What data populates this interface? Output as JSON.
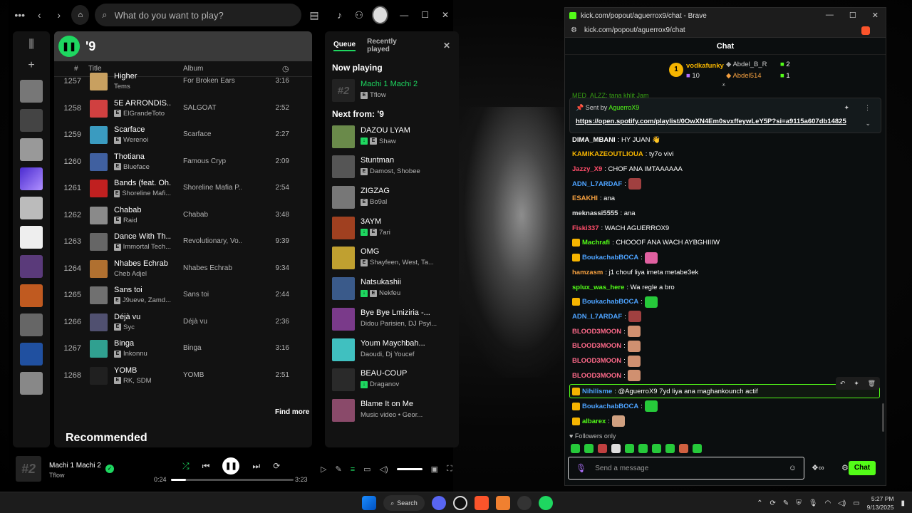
{
  "spotify": {
    "search_placeholder": "What do you want to play?",
    "playlist_title": "'9",
    "columns": {
      "num": "#",
      "title": "Title",
      "album": "Album"
    },
    "tracks": [
      {
        "num": "1257",
        "title": "Higher",
        "artist": "Tems",
        "explicit": false,
        "album": "For Broken Ears",
        "duration": "3:16",
        "color": "#c8a060"
      },
      {
        "num": "1258",
        "title": "5E ARRONDIS...",
        "artist": "ElGrandeToto",
        "explicit": true,
        "album": "SALGOAT",
        "duration": "2:52",
        "color": "#d04040"
      },
      {
        "num": "1259",
        "title": "Scarface",
        "artist": "Werenoi",
        "explicit": true,
        "album": "Scarface",
        "duration": "2:27",
        "color": "#3a9bc0"
      },
      {
        "num": "1260",
        "title": "Thotiana",
        "artist": "Blueface",
        "explicit": true,
        "album": "Famous Cryp",
        "duration": "2:09",
        "color": "#4060a0"
      },
      {
        "num": "1261",
        "title": "Bands (feat. Oh...",
        "artist": "Shoreline Mafi...",
        "explicit": true,
        "album": "Shoreline Mafia P...",
        "duration": "2:54",
        "color": "#c02020"
      },
      {
        "num": "1262",
        "title": "Chabab",
        "artist": "Raid",
        "explicit": true,
        "album": "Chabab",
        "duration": "3:48",
        "color": "#8a8a8a"
      },
      {
        "num": "1263",
        "title": "Dance With Th...",
        "artist": "Immortal Tech...",
        "explicit": true,
        "album": "Revolutionary, Vo...",
        "duration": "9:39",
        "color": "#666"
      },
      {
        "num": "1264",
        "title": "Nhabes Echrab",
        "artist": "Cheb Adjel",
        "explicit": false,
        "album": "Nhabes Echrab",
        "duration": "9:34",
        "color": "#b07030"
      },
      {
        "num": "1265",
        "title": "Sans toi",
        "artist": "J9ueve, Zamd...",
        "explicit": true,
        "album": "Sans toi",
        "duration": "2:44",
        "color": "#707070"
      },
      {
        "num": "1266",
        "title": "Déjà vu",
        "artist": "Syc",
        "explicit": true,
        "album": "Déjà vu",
        "duration": "2:36",
        "color": "#505070"
      },
      {
        "num": "1267",
        "title": "Binga",
        "artist": "Inkonnu",
        "explicit": true,
        "album": "Binga",
        "duration": "3:16",
        "color": "#30a090"
      },
      {
        "num": "1268",
        "title": "YOMB",
        "artist": "RK, SDM",
        "explicit": true,
        "album": "YOMB",
        "duration": "2:51",
        "color": "#202020"
      }
    ],
    "find_more": "Find more",
    "recommended": "Recommended",
    "queue": {
      "tab_queue": "Queue",
      "tab_recent": "Recently played",
      "now_playing_label": "Now playing",
      "now_playing": {
        "title": "Machi 1 Machi 2",
        "artist": "Tflow"
      },
      "next_label": "Next from: '9",
      "items": [
        {
          "title": "DAZOU LYAM",
          "artist": "Shaw",
          "dl": true,
          "explicit": true,
          "color": "#6a8a4a"
        },
        {
          "title": "Stuntman",
          "artist": "Damost, Shobee",
          "dl": false,
          "explicit": true,
          "color": "#555"
        },
        {
          "title": "ZIGZAG",
          "artist": "Bo9al",
          "dl": false,
          "explicit": true,
          "color": "#777"
        },
        {
          "title": "3AYM",
          "artist": "7ari",
          "dl": true,
          "explicit": true,
          "color": "#a04020"
        },
        {
          "title": "OMG",
          "artist": "Shayfeen, West, Ta...",
          "dl": false,
          "explicit": true,
          "color": "#c0a030"
        },
        {
          "title": "Natsukashii",
          "artist": "Nekfeu",
          "dl": true,
          "explicit": true,
          "color": "#3a5a8a"
        },
        {
          "title": "Bye Bye Lmiziria -...",
          "artist": "Didou Parisien, DJ Psyi...",
          "dl": false,
          "explicit": false,
          "color": "#7a3a8a"
        },
        {
          "title": "Youm Maychbah...",
          "artist": "Daoudi, Dj Youcef",
          "dl": false,
          "explicit": false,
          "color": "#40c0c0"
        },
        {
          "title": "BEAU-COUP",
          "artist": "Draganov",
          "dl": true,
          "explicit": false,
          "color": "#2a2a2a"
        },
        {
          "title": "Blame It on Me",
          "artist": "Music video • Geor...",
          "dl": false,
          "explicit": false,
          "color": "#8a4a6a"
        }
      ]
    },
    "player": {
      "art_text": "#2",
      "title": "Machi 1 Machi 2",
      "artist": "Tflow",
      "current": "0:24",
      "total": "3:23",
      "progress": 0.12
    }
  },
  "browser": {
    "title": "kick.com/popout/aguerrox9/chat - Brave",
    "url": "kick.com/popout/aguerrox9/chat",
    "chat_header": "Chat",
    "leaders": {
      "first": {
        "rank": "1",
        "name": "vodkafunky",
        "count": "10"
      },
      "second": {
        "name": "Abdel_B_R",
        "count": "2"
      },
      "third": {
        "name": "Abdel514",
        "count": "1"
      }
    },
    "pinned": {
      "sent_by": "Sent by",
      "user": "AguerroX9",
      "link": "https://open.spotify.com/playlist/0OwXN4Em0svxffeywLeY5P?si=a9115a607db14825"
    },
    "partial_top": "MED_ALZZ: tana khlit Jam",
    "messages": [
      {
        "user": "DIMA_MBANI",
        "color": "#ffffff",
        "text": ": HY JUAN 👋"
      },
      {
        "user": "KAMIKAZEOUTLIOUA",
        "color": "#f5b400",
        "text": ": ty7o vivi"
      },
      {
        "user": "Jazzy_X9",
        "color": "#ff4d6a",
        "text": ": CHOF ANA IMTAAAAAA"
      },
      {
        "user": "ADN_L7ARDAF",
        "color": "#4da3ff",
        "text": ":",
        "emote": "#a04040"
      },
      {
        "user": "ESAKHI",
        "color": "#f5a040",
        "text": ": ana"
      },
      {
        "user": "meknassi5555",
        "color": "#e0e0e0",
        "text": ": ana"
      },
      {
        "user": "Fiski337",
        "color": "#ff4d6a",
        "text": ": WACH AGUERROX9"
      },
      {
        "user": "Machrafi",
        "color": "#53fc18",
        "text": ": CHOOOF ANA WACH AYBGHIIIW",
        "badge": true
      },
      {
        "user": "BoukachabBOCA",
        "color": "#4da3ff",
        "text": ":",
        "emote": "#e060a0",
        "badge": true
      },
      {
        "user": "hamzasm",
        "color": "#f5a040",
        "text": ": j1 chouf liya imeta metabe3ek"
      },
      {
        "user": "splux_was_here",
        "color": "#53fc18",
        "text": ": Wa regle a bro"
      },
      {
        "user": "BoukachabBOCA",
        "color": "#4da3ff",
        "text": ":",
        "emote": "#26c93a",
        "badge": true
      },
      {
        "user": "ADN_L7ARDAF",
        "color": "#4da3ff",
        "text": ":",
        "emote": "#a04040"
      },
      {
        "user": "BLOOD3MOON",
        "color": "#ff6a8a",
        "text": ":",
        "emote": "#d09070"
      },
      {
        "user": "BLOOD3MOON",
        "color": "#ff6a8a",
        "text": ":",
        "emote": "#d09070"
      },
      {
        "user": "BLOOD3MOON",
        "color": "#ff6a8a",
        "text": ":",
        "emote": "#d09070"
      },
      {
        "user": "BLOOD3MOON",
        "color": "#ff6a8a",
        "text": ":",
        "emote": "#d09070"
      }
    ],
    "highlighted": {
      "user": "Nihilisme",
      "color": "#4da3ff",
      "text": ": @AguerroX9 7yd liya ana maghankounch actif"
    },
    "after": [
      {
        "user": "BoukachabBOCA",
        "color": "#4da3ff",
        "text": ":",
        "emote": "#26c93a",
        "badge": true
      },
      {
        "user": "albarex",
        "color": "#53fc18",
        "text": ":",
        "emote": "#d0a080",
        "badge": true
      }
    ],
    "followers_only": "Followers only",
    "input_placeholder": "Send a message",
    "chat_button": "Chat"
  },
  "taskbar": {
    "search": "Search",
    "time": "5:27 PM",
    "date": "9/13/2025"
  }
}
